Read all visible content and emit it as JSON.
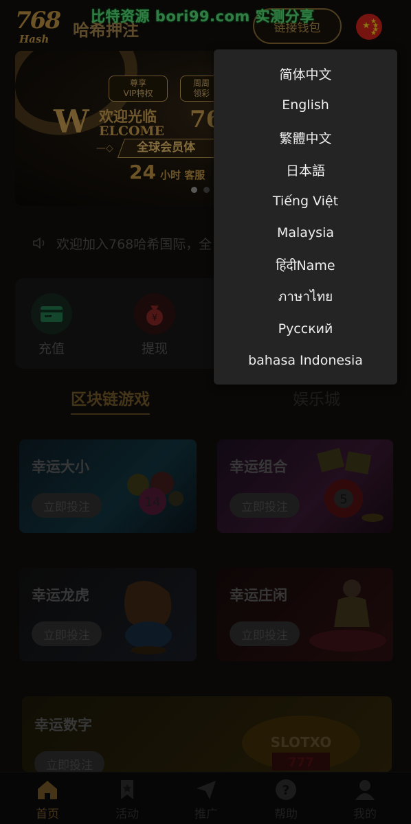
{
  "watermark": "比特资源 bori99.com 实测分享",
  "header": {
    "logo_number": "768",
    "logo_sub": "Hash",
    "brand_name": "哈希押注",
    "wallet_button": "链接钱包",
    "flag_icon": "china-flag-icon"
  },
  "banner": {
    "tag_left_line1": "尊享",
    "tag_left_line2": "VIP特权",
    "tag_right_line1": "周周",
    "tag_right_line2": "领彩",
    "welcome_cn": "欢迎光临",
    "welcome_big": "W",
    "welcome_en": "ELCOME",
    "welcome_num": "768",
    "strip_text": "全球会员体",
    "hours_num": "24",
    "hours_text": "小时 客服"
  },
  "notice": {
    "text": "欢迎加入768哈希国际，全"
  },
  "actions": [
    {
      "label": "充值",
      "icon": "wallet-icon",
      "color": "#1d3b2b"
    },
    {
      "label": "提现",
      "icon": "money-bag-icon",
      "color": "#3b1616"
    }
  ],
  "tabs": [
    {
      "label": "区块链游戏",
      "active": true
    },
    {
      "label": "娱乐城",
      "active": false
    }
  ],
  "games": [
    {
      "title": "幸运大小",
      "button": "立即投注",
      "theme": "lottery-balls"
    },
    {
      "title": "幸运组合",
      "button": "立即投注",
      "theme": "lottery-ball-5"
    },
    {
      "title": "幸运龙虎",
      "button": "立即投注",
      "theme": "tiger"
    },
    {
      "title": "幸运庄闲",
      "button": "立即投注",
      "theme": "dealer"
    },
    {
      "title": "幸运数字",
      "button": "立即投注",
      "theme": "slot-machine",
      "art_text": "SLOTXO",
      "art_digits": "777"
    }
  ],
  "bottom_nav": [
    {
      "label": "首页",
      "icon": "home-icon",
      "active": true
    },
    {
      "label": "活动",
      "icon": "bookmark-icon",
      "active": false
    },
    {
      "label": "推广",
      "icon": "send-icon",
      "active": false
    },
    {
      "label": "帮助",
      "icon": "help-icon",
      "active": false
    },
    {
      "label": "我的",
      "icon": "user-icon",
      "active": false
    }
  ],
  "language_menu": {
    "items": [
      "简体中文",
      "English",
      "繁體中文",
      "日本語",
      "Tiếng Việt",
      "Malaysia",
      "हिंदीName",
      "ภาษาไทย",
      "Русский",
      "bahasa Indonesia"
    ]
  },
  "colors": {
    "accent_gold": "#8f7444",
    "menu_bg": "#242424",
    "menu_text": "#eeeeee"
  }
}
